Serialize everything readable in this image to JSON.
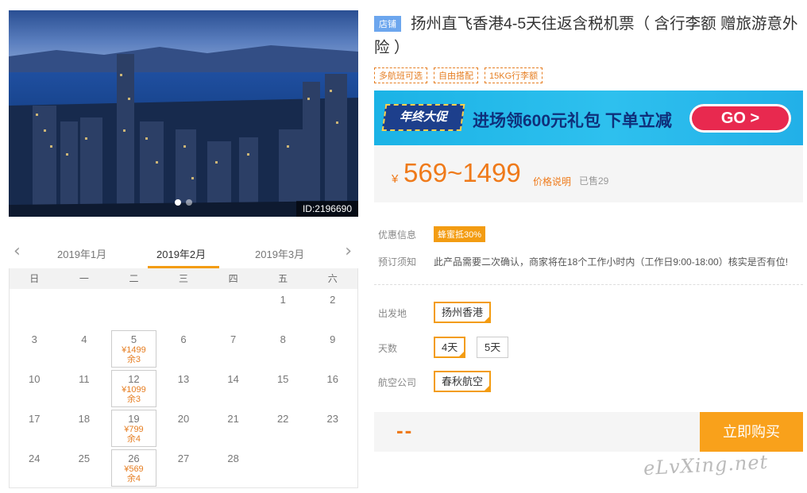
{
  "hero": {
    "id_label": "ID:2196690",
    "dots": 2,
    "active_dot": 0
  },
  "calendar": {
    "prev_icon": "chevron-left-icon",
    "next_icon": "chevron-right-icon",
    "months": [
      "2019年1月",
      "2019年2月",
      "2019年3月"
    ],
    "active_month": 1,
    "weekdays": [
      "日",
      "一",
      "二",
      "三",
      "四",
      "五",
      "六"
    ],
    "weeks": [
      [
        null,
        null,
        null,
        null,
        null,
        {
          "day": "1"
        },
        {
          "day": "2"
        }
      ],
      [
        {
          "day": "3"
        },
        {
          "day": "4"
        },
        {
          "day": "5",
          "price": "¥1499",
          "left": "余3"
        },
        {
          "day": "6"
        },
        {
          "day": "7"
        },
        {
          "day": "8"
        },
        {
          "day": "9"
        }
      ],
      [
        {
          "day": "10"
        },
        {
          "day": "11"
        },
        {
          "day": "12",
          "price": "¥1099",
          "left": "余3"
        },
        {
          "day": "13"
        },
        {
          "day": "14"
        },
        {
          "day": "15"
        },
        {
          "day": "16"
        }
      ],
      [
        {
          "day": "17"
        },
        {
          "day": "18"
        },
        {
          "day": "19",
          "price": "¥799",
          "left": "余4"
        },
        {
          "day": "20"
        },
        {
          "day": "21"
        },
        {
          "day": "22"
        },
        {
          "day": "23"
        }
      ],
      [
        {
          "day": "24"
        },
        {
          "day": "25"
        },
        {
          "day": "26",
          "price": "¥569",
          "left": "余4"
        },
        {
          "day": "27"
        },
        {
          "day": "28"
        },
        null,
        null
      ]
    ]
  },
  "product": {
    "shop_tag": "店铺",
    "title": "扬州直飞香港4-5天往返含税机票（ 含行李额 赠旅游意外险 ）",
    "tags": [
      "多航班可选",
      "自由搭配",
      "15KG行李额"
    ]
  },
  "banner": {
    "badge": "年终大促",
    "text_prefix": "进场领",
    "text_amount": "600元礼包",
    "text_suffix": "下单立减",
    "go": "GO >"
  },
  "price": {
    "currency": "¥",
    "range": "569~1499",
    "note": "价格说明",
    "sold": "已售29"
  },
  "info": {
    "discount_label": "优惠信息",
    "discount_badge": "蜂蜜抵30%",
    "notice_label": "预订须知",
    "notice_text": "此产品需要二次确认，商家将在18个工作小时内（工作日9:00-18:00）核实是否有位!"
  },
  "options": {
    "departure_label": "出发地",
    "departure": [
      "扬州香港"
    ],
    "days_label": "天数",
    "days": [
      "4天",
      "5天"
    ],
    "airline_label": "航空公司",
    "airline": [
      "春秋航空"
    ]
  },
  "buy": {
    "total": "--",
    "button": "立即购买"
  },
  "watermark": "eLvXing.net"
}
